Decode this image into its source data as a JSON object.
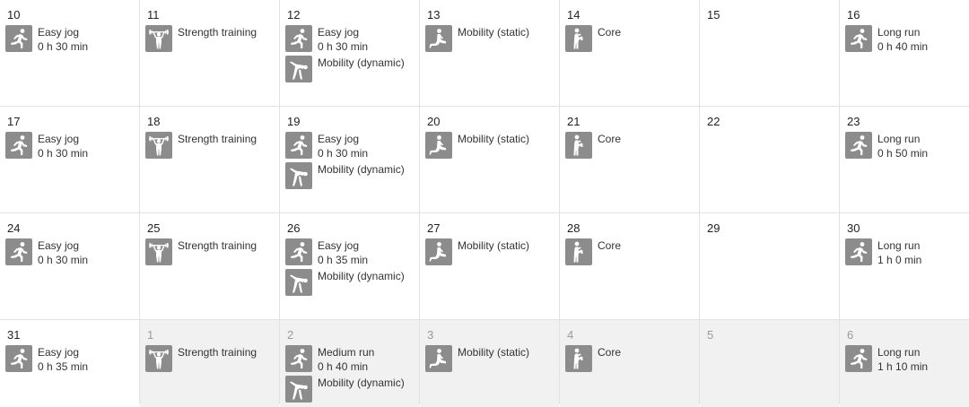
{
  "calendar": {
    "weeks": [
      {
        "days": [
          {
            "num": "10",
            "other": false,
            "activities": [
              {
                "icon": "running-icon",
                "name": "Easy jog",
                "duration": "0 h 30 min"
              }
            ]
          },
          {
            "num": "11",
            "other": false,
            "activities": [
              {
                "icon": "strength-training-icon",
                "name": "Strength training",
                "duration": ""
              }
            ]
          },
          {
            "num": "12",
            "other": false,
            "activities": [
              {
                "icon": "running-icon",
                "name": "Easy jog",
                "duration": "0 h 30 min"
              },
              {
                "icon": "dynamic-stretch-icon",
                "name": "Mobility (dynamic)",
                "duration": ""
              }
            ]
          },
          {
            "num": "13",
            "other": false,
            "activities": [
              {
                "icon": "static-stretch-icon",
                "name": "Mobility (static)",
                "duration": ""
              }
            ]
          },
          {
            "num": "14",
            "other": false,
            "activities": [
              {
                "icon": "core-icon",
                "name": "Core",
                "duration": ""
              }
            ]
          },
          {
            "num": "15",
            "other": false,
            "activities": []
          },
          {
            "num": "16",
            "other": false,
            "activities": [
              {
                "icon": "running-icon",
                "name": "Long run",
                "duration": "0 h 40 min"
              }
            ]
          }
        ]
      },
      {
        "days": [
          {
            "num": "17",
            "other": false,
            "activities": [
              {
                "icon": "running-icon",
                "name": "Easy jog",
                "duration": "0 h 30 min"
              }
            ]
          },
          {
            "num": "18",
            "other": false,
            "activities": [
              {
                "icon": "strength-training-icon",
                "name": "Strength training",
                "duration": ""
              }
            ]
          },
          {
            "num": "19",
            "other": false,
            "activities": [
              {
                "icon": "running-icon",
                "name": "Easy jog",
                "duration": "0 h 30 min"
              },
              {
                "icon": "dynamic-stretch-icon",
                "name": "Mobility (dynamic)",
                "duration": ""
              }
            ]
          },
          {
            "num": "20",
            "other": false,
            "activities": [
              {
                "icon": "static-stretch-icon",
                "name": "Mobility (static)",
                "duration": ""
              }
            ]
          },
          {
            "num": "21",
            "other": false,
            "activities": [
              {
                "icon": "core-icon",
                "name": "Core",
                "duration": ""
              }
            ]
          },
          {
            "num": "22",
            "other": false,
            "activities": []
          },
          {
            "num": "23",
            "other": false,
            "activities": [
              {
                "icon": "running-icon",
                "name": "Long run",
                "duration": "0 h 50 min"
              }
            ]
          }
        ]
      },
      {
        "days": [
          {
            "num": "24",
            "other": false,
            "activities": [
              {
                "icon": "running-icon",
                "name": "Easy jog",
                "duration": "0 h 30 min"
              }
            ]
          },
          {
            "num": "25",
            "other": false,
            "activities": [
              {
                "icon": "strength-training-icon",
                "name": "Strength training",
                "duration": ""
              }
            ]
          },
          {
            "num": "26",
            "other": false,
            "activities": [
              {
                "icon": "running-icon",
                "name": "Easy jog",
                "duration": "0 h 35 min"
              },
              {
                "icon": "dynamic-stretch-icon",
                "name": "Mobility (dynamic)",
                "duration": ""
              }
            ]
          },
          {
            "num": "27",
            "other": false,
            "activities": [
              {
                "icon": "static-stretch-icon",
                "name": "Mobility (static)",
                "duration": ""
              }
            ]
          },
          {
            "num": "28",
            "other": false,
            "activities": [
              {
                "icon": "core-icon",
                "name": "Core",
                "duration": ""
              }
            ]
          },
          {
            "num": "29",
            "other": false,
            "activities": []
          },
          {
            "num": "30",
            "other": false,
            "activities": [
              {
                "icon": "running-icon",
                "name": "Long run",
                "duration": "1 h 0 min"
              }
            ]
          }
        ]
      },
      {
        "days": [
          {
            "num": "31",
            "other": false,
            "activities": [
              {
                "icon": "running-icon",
                "name": "Easy jog",
                "duration": "0 h 35 min"
              }
            ]
          },
          {
            "num": "1",
            "other": true,
            "activities": [
              {
                "icon": "strength-training-icon",
                "name": "Strength training",
                "duration": ""
              }
            ]
          },
          {
            "num": "2",
            "other": true,
            "activities": [
              {
                "icon": "running-icon",
                "name": "Medium run",
                "duration": "0 h 40 min"
              },
              {
                "icon": "dynamic-stretch-icon",
                "name": "Mobility (dynamic)",
                "duration": ""
              }
            ]
          },
          {
            "num": "3",
            "other": true,
            "activities": [
              {
                "icon": "static-stretch-icon",
                "name": "Mobility (static)",
                "duration": ""
              }
            ]
          },
          {
            "num": "4",
            "other": true,
            "activities": [
              {
                "icon": "core-icon",
                "name": "Core",
                "duration": ""
              }
            ]
          },
          {
            "num": "5",
            "other": true,
            "activities": []
          },
          {
            "num": "6",
            "other": true,
            "activities": [
              {
                "icon": "running-icon",
                "name": "Long run",
                "duration": "1 h 10 min"
              }
            ]
          }
        ]
      }
    ]
  },
  "colors": {
    "icon_bg": "#8c8c8c",
    "icon_fg": "#ffffff",
    "other_month_bg": "#f1f1f1",
    "grid_line": "#e2e2e2"
  }
}
